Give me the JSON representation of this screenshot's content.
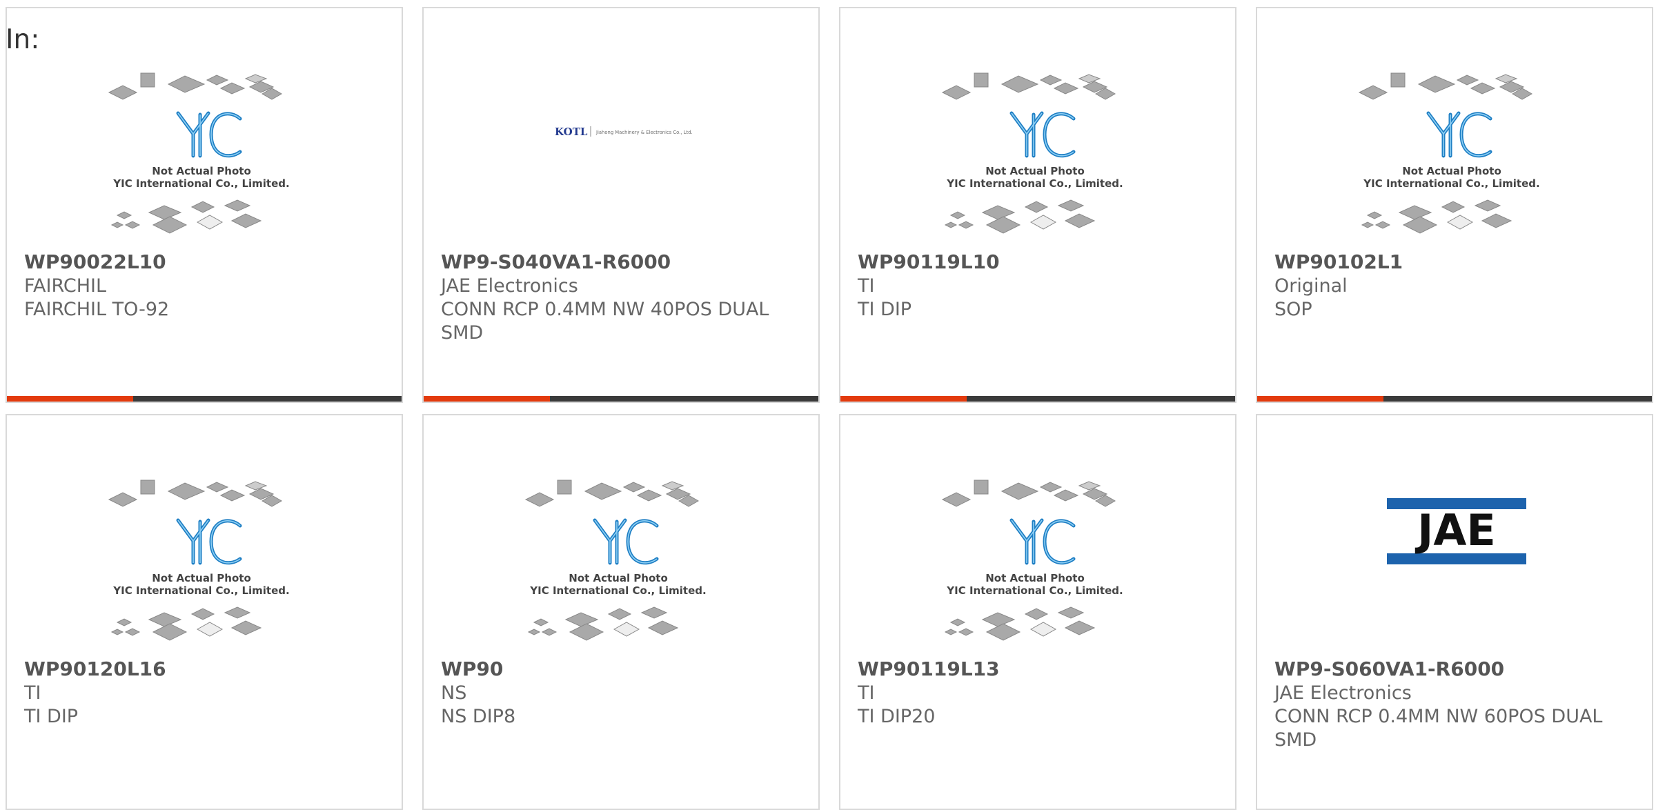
{
  "header": {
    "in_label": "In:"
  },
  "placeholder": {
    "line1": "Not Actual Photo",
    "line2": "YIC International Co., Limited.",
    "logo": "YIC"
  },
  "kotl": {
    "logo": "KOTL",
    "company": "Jiahong Machinery & Electronics Co., Ltd."
  },
  "jae_logo": "JAE",
  "products": [
    {
      "part": "WP90022L10",
      "manufacturer": "FAIRCHIL",
      "description": "FAIRCHIL TO-92",
      "image": "placeholder"
    },
    {
      "part": "WP9-S040VA1-R6000",
      "manufacturer": "JAE Electronics",
      "description": "CONN RCP 0.4MM NW 40POS DUAL SMD",
      "image": "kotl-logo"
    },
    {
      "part": "WP90119L10",
      "manufacturer": "TI",
      "description": "TI DIP",
      "image": "placeholder"
    },
    {
      "part": "WP90102L1",
      "manufacturer": "Original",
      "description": "SOP",
      "image": "placeholder"
    },
    {
      "part": "WP90120L16",
      "manufacturer": "TI",
      "description": "TI DIP",
      "image": "placeholder"
    },
    {
      "part": "WP90",
      "manufacturer": "NS",
      "description": "NS DIP8",
      "image": "placeholder"
    },
    {
      "part": "WP90119L13",
      "manufacturer": "TI",
      "description": "TI DIP20",
      "image": "placeholder"
    },
    {
      "part": "WP9-S060VA1-R6000",
      "manufacturer": "JAE Electronics",
      "description": "CONN RCP 0.4MM NW 60POS DUAL SMD",
      "image": "jae-logo"
    }
  ],
  "colors": {
    "accent": "#e33a0d",
    "bar": "#3a3a3a",
    "border": "#d9d9d9",
    "logo_blue": "#1f7fc4",
    "jae_blue": "#1d63ad"
  }
}
